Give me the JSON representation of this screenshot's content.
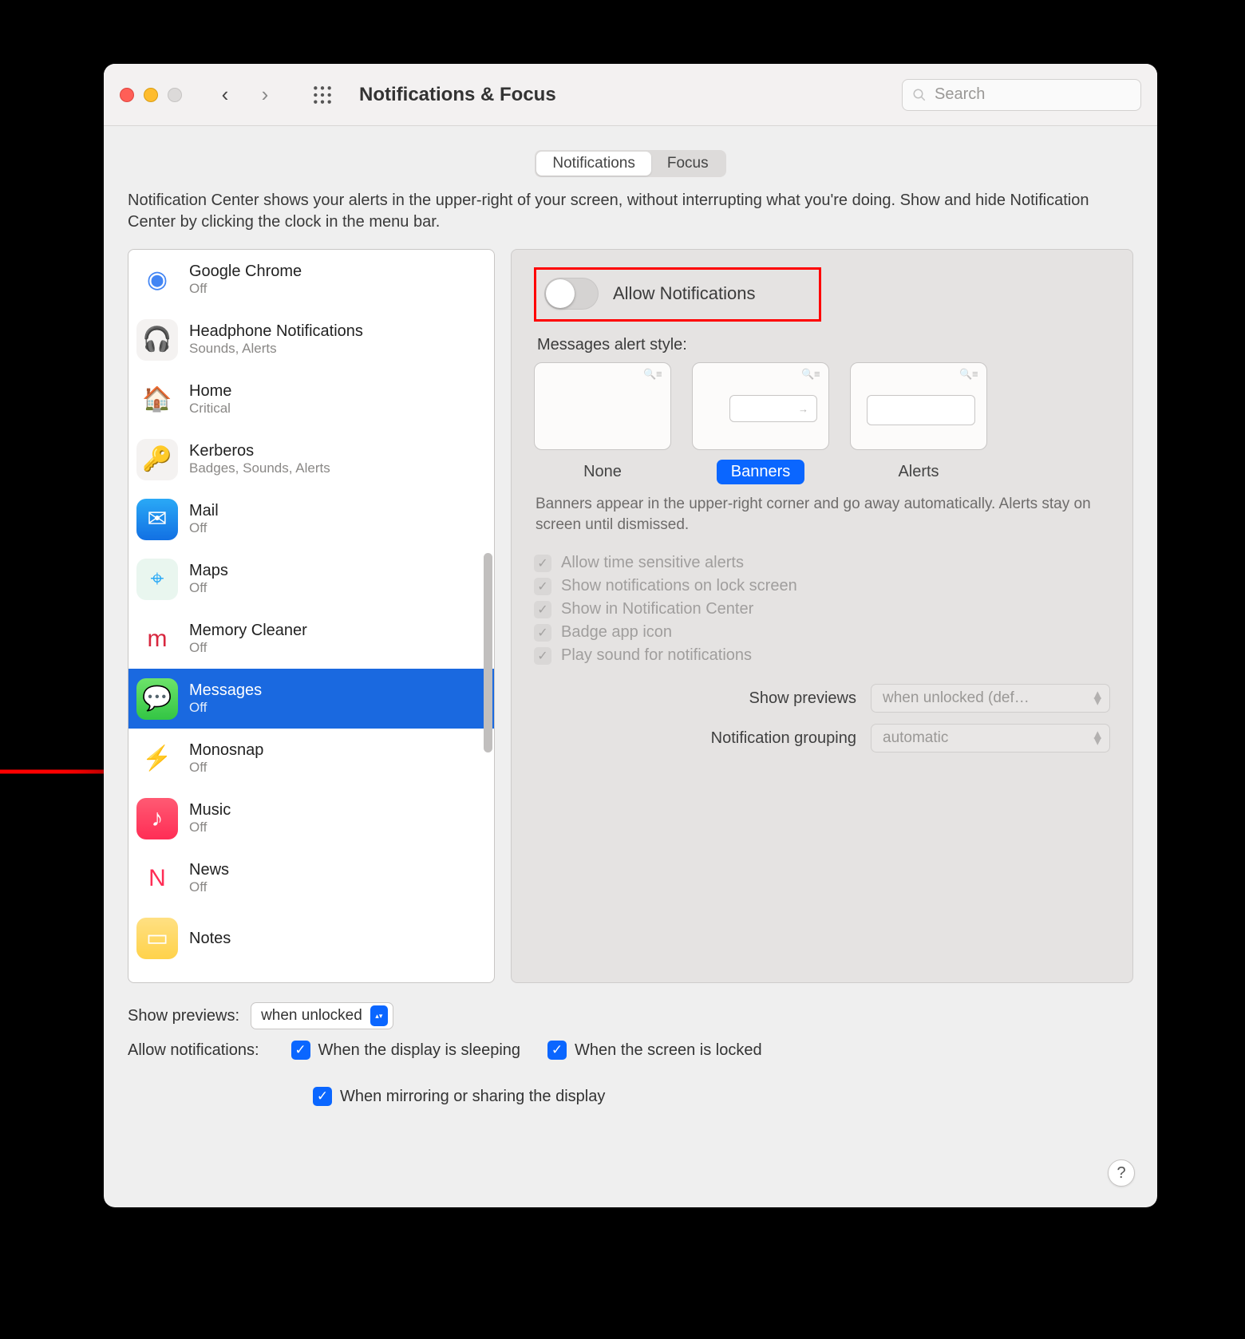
{
  "window": {
    "title": "Notifications & Focus",
    "search_placeholder": "Search"
  },
  "tabs": {
    "notifications": "Notifications",
    "focus": "Focus",
    "selected": "notifications"
  },
  "description": "Notification Center shows your alerts in the upper-right of your screen, without interrupting what you're doing. Show and hide Notification Center by clicking the clock in the menu bar.",
  "apps": [
    {
      "name": "Google Chrome",
      "sub": "Off",
      "icon_bg": "#ffffff",
      "icon_glyph": "◉",
      "icon_color": "#4285f4"
    },
    {
      "name": "Headphone Notifications",
      "sub": "Sounds, Alerts",
      "icon_bg": "#f4f2f1",
      "icon_glyph": "🎧",
      "icon_color": "#bbb"
    },
    {
      "name": "Home",
      "sub": "Critical",
      "icon_bg": "#ffffff",
      "icon_glyph": "🏠",
      "icon_color": "#ff8a00"
    },
    {
      "name": "Kerberos",
      "sub": "Badges, Sounds, Alerts",
      "icon_bg": "#f4f2f1",
      "icon_glyph": "🔑",
      "icon_color": "#caa34a"
    },
    {
      "name": "Mail",
      "sub": "Off",
      "icon_bg": "linear-gradient(#2aa9f6,#1270e3)",
      "icon_glyph": "✉",
      "icon_color": "#fff"
    },
    {
      "name": "Maps",
      "sub": "Off",
      "icon_bg": "#e9f6ef",
      "icon_glyph": "⌖",
      "icon_color": "#2aa9f6"
    },
    {
      "name": "Memory Cleaner",
      "sub": "Off",
      "icon_bg": "#ffffff",
      "icon_glyph": "m",
      "icon_color": "#d8273f"
    },
    {
      "name": "Messages",
      "sub": "Off",
      "icon_bg": "linear-gradient(#6de36a,#33c544)",
      "icon_glyph": "💬",
      "icon_color": "#fff",
      "selected": true
    },
    {
      "name": "Monosnap",
      "sub": "Off",
      "icon_bg": "#ffffff",
      "icon_glyph": "⚡",
      "icon_color": "#f5a623"
    },
    {
      "name": "Music",
      "sub": "Off",
      "icon_bg": "linear-gradient(#ff5a73,#ff2d55)",
      "icon_glyph": "♪",
      "icon_color": "#fff"
    },
    {
      "name": "News",
      "sub": "Off",
      "icon_bg": "#ffffff",
      "icon_glyph": "N",
      "icon_color": "#ff2d55"
    },
    {
      "name": "Notes",
      "sub": "",
      "icon_bg": "linear-gradient(#ffe083,#ffd24a)",
      "icon_glyph": "▭",
      "icon_color": "#fff"
    }
  ],
  "detail": {
    "allow_label": "Allow Notifications",
    "allow_on": false,
    "alert_style_label": "Messages alert style:",
    "styles": {
      "none": "None",
      "banners": "Banners",
      "alerts": "Alerts",
      "selected": "banners"
    },
    "style_desc": "Banners appear in the upper-right corner and go away automatically. Alerts stay on screen until dismissed.",
    "checks": [
      {
        "label": "Allow time sensitive alerts",
        "checked": true
      },
      {
        "label": "Show notifications on lock screen",
        "checked": true
      },
      {
        "label": "Show in Notification Center",
        "checked": true
      },
      {
        "label": "Badge app icon",
        "checked": true
      },
      {
        "label": "Play sound for notifications",
        "checked": true
      }
    ],
    "show_previews_label": "Show previews",
    "show_previews_value": "when unlocked (def…",
    "grouping_label": "Notification grouping",
    "grouping_value": "automatic"
  },
  "footer": {
    "show_previews_label": "Show previews:",
    "show_previews_value": "when unlocked",
    "allow_label": "Allow notifications:",
    "opts": [
      {
        "label": "When the display is sleeping",
        "checked": true
      },
      {
        "label": "When the screen is locked",
        "checked": true
      },
      {
        "label": "When mirroring or sharing the display",
        "checked": true
      }
    ]
  },
  "help_glyph": "?"
}
